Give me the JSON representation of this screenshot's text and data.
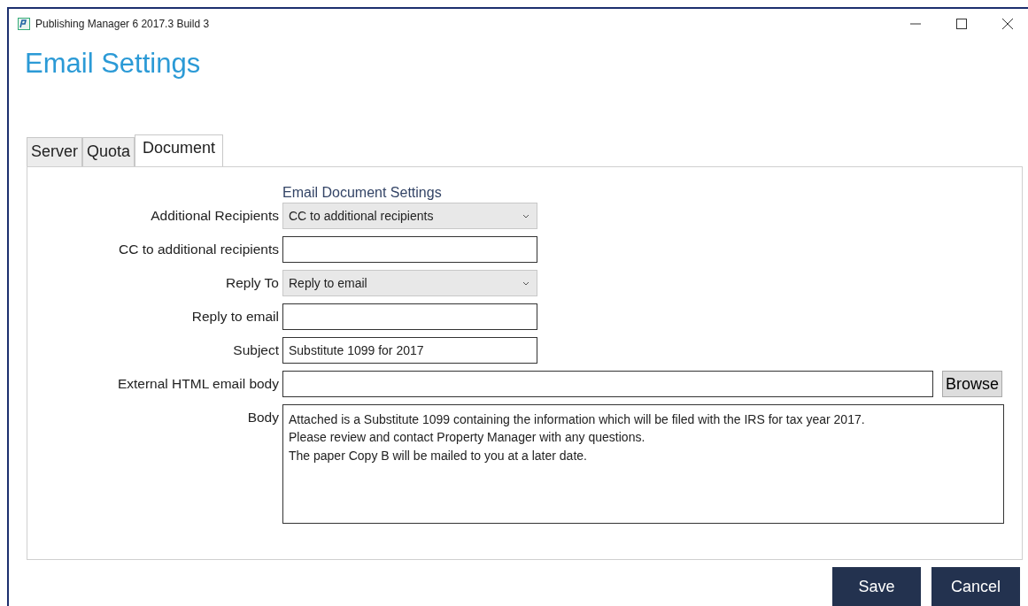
{
  "window": {
    "title": "Publishing Manager 6 2017.3 Build 3"
  },
  "heading": "Email Settings",
  "tabs": [
    {
      "label": "Server",
      "selected": false
    },
    {
      "label": "Quota",
      "selected": false
    },
    {
      "label": "Document",
      "selected": true
    }
  ],
  "section_title": "Email Document Settings",
  "fields": [
    {
      "kind": "select",
      "label": "Additional Recipients",
      "value": "CC to additional recipients"
    },
    {
      "kind": "text",
      "label": "CC to additional recipients"
    },
    {
      "kind": "select",
      "label": "Reply To",
      "value": "Reply to email"
    },
    {
      "kind": "text",
      "label": "Reply to email"
    },
    {
      "kind": "text",
      "label": "Subject",
      "value": "Substitute 1099 for 2017"
    },
    {
      "kind": "file",
      "label": "External HTML email body",
      "button": "Browse"
    },
    {
      "kind": "textarea",
      "label": "Body",
      "value": "Attached is a Substitute 1099 containing the information which will be filed with the IRS for tax year 2017.\nPlease review and contact Property Manager with any questions.\nThe paper Copy B will be mailed to you at a later date."
    }
  ],
  "buttons": [
    "Save",
    "Cancel"
  ]
}
